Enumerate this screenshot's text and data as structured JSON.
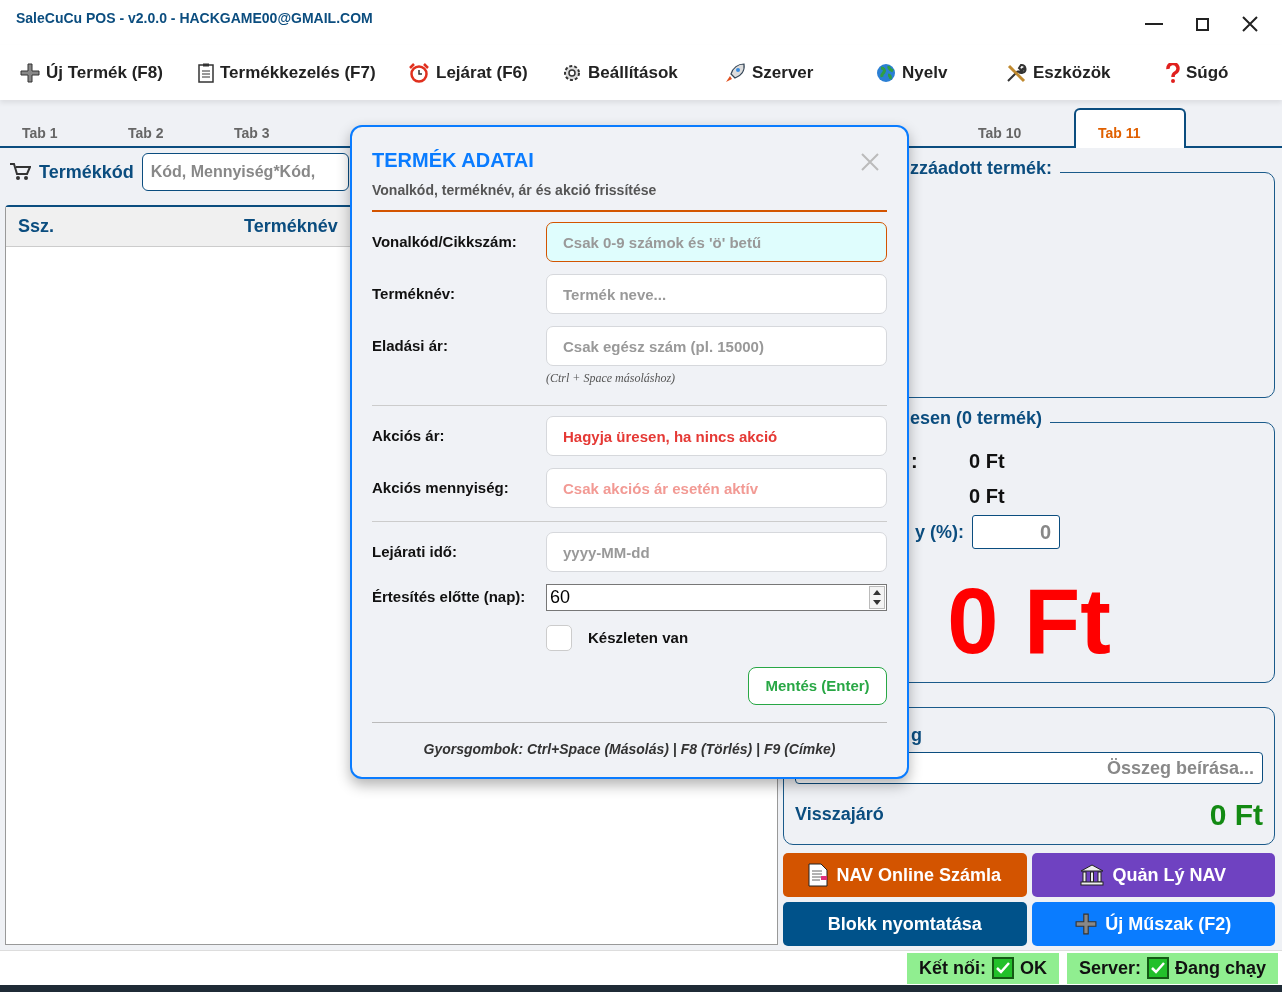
{
  "window": {
    "title": "SaleCuCu POS - v2.0.0 - HACKGAME00@GMAIL.COM"
  },
  "menu": [
    {
      "label": "Új Termék (F8)"
    },
    {
      "label": "Termékkezelés (F7)"
    },
    {
      "label": "Lejárat (F6)"
    },
    {
      "label": "Beállítások"
    },
    {
      "label": "Szerver"
    },
    {
      "label": "Nyelv"
    },
    {
      "label": "Eszközök"
    },
    {
      "label": "Súgó"
    }
  ],
  "tabs": [
    {
      "label": "Tab 1",
      "selected": false
    },
    {
      "label": "Tab 2",
      "selected": false
    },
    {
      "label": "Tab 3",
      "selected": false
    },
    {
      "label": "Tab 10",
      "selected": false
    },
    {
      "label": "Tab 11",
      "selected": true
    }
  ],
  "product_search": {
    "label": "Termékkód",
    "placeholder": "Kód, Mennyiség*Kód,"
  },
  "table": {
    "columns": [
      "Ssz.",
      "Terméknév"
    ]
  },
  "added_product": {
    "title": "zzáadott termék:"
  },
  "summary": {
    "title": "esen (0 termék)",
    "rows": [
      {
        "label": ":",
        "value": "0 Ft"
      },
      {
        "value": "0 Ft"
      }
    ],
    "discount": {
      "label": "y (%):",
      "placeholder": "0"
    },
    "total": "0 Ft"
  },
  "payment": {
    "title": "g",
    "placeholder": "Összeg beírása...",
    "change_label": "Visszajáró",
    "change_value": "0 Ft"
  },
  "actions": [
    {
      "label": "NAV Online Számla",
      "color": "#d35400"
    },
    {
      "label": "Quản Lý NAV",
      "color": "#6f42c1"
    },
    {
      "label": "Blokk nyomtatása",
      "color": "#00528a"
    },
    {
      "label": "Új Műszak (F2)",
      "color": "#0a7cff"
    }
  ],
  "status_bar": [
    {
      "label": "Kết nối:",
      "value": "OK",
      "ok": true
    },
    {
      "label": "Server:",
      "value": "Đang chạy",
      "ok": true
    }
  ],
  "dialog": {
    "title": "TERMÉK ADATAI",
    "subtitle": "Vonalkód, terméknév, ár és akció frissítése",
    "sections": [
      {
        "fields": [
          {
            "kind": "text",
            "label": "Vonalkód/Cikkszám:",
            "placeholder": "Csak 0-9 számok és 'ö' betű",
            "focused": true
          },
          {
            "kind": "text",
            "label": "Terméknév:",
            "placeholder": "Termék neve...",
            "focused": false
          },
          {
            "kind": "text",
            "label": "Eladási ár:",
            "placeholder": "Csak egész szám (pl. 15000)",
            "focused": false,
            "hint": "(Ctrl + Space másoláshoz)"
          }
        ]
      },
      {
        "fields": [
          {
            "kind": "text",
            "label": "Akciós ár:",
            "placeholder": "Hagyja üresen, ha nincs akció",
            "focused": false,
            "color": "#e53935"
          },
          {
            "kind": "text",
            "label": "Akciós mennyiség:",
            "placeholder": "Csak akciós ár esetén aktív",
            "focused": false,
            "color": "#f29a94"
          }
        ]
      },
      {
        "fields": [
          {
            "kind": "text",
            "label": "Lejárati idő:",
            "placeholder": "yyyy-MM-dd",
            "focused": false
          },
          {
            "kind": "number",
            "label": "Értesítés előtte (nap):",
            "value": "60"
          },
          {
            "kind": "checkbox",
            "label": "Készleten van",
            "checked": false
          }
        ]
      }
    ],
    "save_button": "Mentés (Enter)",
    "shortcuts": "Gyorsgombok: Ctrl+Space (Másolás) | F8 (Törlés) | F9 (Címke)"
  }
}
